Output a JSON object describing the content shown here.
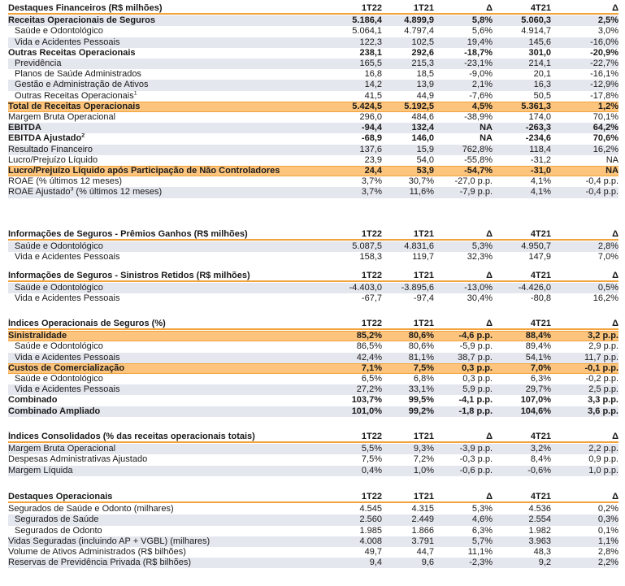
{
  "sections": [
    {
      "header": {
        "label": "Destaques Financeiros (R$ milhões)",
        "v": [
          "1T22",
          "1T21",
          "Δ",
          "4T21",
          "Δ"
        ]
      },
      "rows": [
        {
          "label": "Receitas Operacionais de Seguros",
          "v": [
            "5.186,4",
            "4.899,9",
            "5,8%",
            "5.060,3",
            "2,5%"
          ],
          "style": "bold",
          "shade": true
        },
        {
          "label": "Saúde e Odontológico",
          "v": [
            "5.064,1",
            "4.797,4",
            "5,6%",
            "4.914,7",
            "3,0%"
          ],
          "indent": true
        },
        {
          "label": "Vida e Acidentes Pessoais",
          "v": [
            "122,3",
            "102,5",
            "19,4%",
            "145,6",
            "-16,0%"
          ],
          "indent": true,
          "shade": true
        },
        {
          "label": "Outras Receitas Operacionais",
          "v": [
            "238,1",
            "292,6",
            "-18,7%",
            "301,0",
            "-20,9%"
          ],
          "style": "bold"
        },
        {
          "label": "Previdência",
          "v": [
            "165,5",
            "215,3",
            "-23,1%",
            "214,1",
            "-22,7%"
          ],
          "indent": true,
          "shade": true
        },
        {
          "label": "Planos de Saúde Administrados",
          "v": [
            "16,8",
            "18,5",
            "-9,0%",
            "20,1",
            "-16,1%"
          ],
          "indent": true
        },
        {
          "label": "Gestão e Administração de Ativos",
          "v": [
            "14,2",
            "13,9",
            "2,1%",
            "16,3",
            "-12,9%"
          ],
          "indent": true,
          "shade": true
        },
        {
          "label": "Outras Receitas Operacionais",
          "sup": "1",
          "v": [
            "41,5",
            "44,9",
            "-7,6%",
            "50,5",
            "-17,8%"
          ],
          "indent": true
        },
        {
          "label": "Total de Receitas Operacionais",
          "v": [
            "5.424,5",
            "5.192,5",
            "4,5%",
            "5.361,3",
            "1,2%"
          ],
          "style": "hl"
        },
        {
          "label": "Margem Bruta Operacional",
          "v": [
            "296,0",
            "484,6",
            "-38,9%",
            "174,0",
            "70,1%"
          ]
        },
        {
          "label": "EBITDA",
          "v": [
            "-94,4",
            "132,4",
            "NA",
            "-263,3",
            "64,2%"
          ],
          "style": "bold",
          "shade": true
        },
        {
          "label": "EBITDA Ajustado",
          "sup": "2",
          "v": [
            "-68,9",
            "146,0",
            "NA",
            "-234,6",
            "70,6%"
          ],
          "style": "bold"
        },
        {
          "label": "Resultado Financeiro",
          "v": [
            "137,6",
            "15,9",
            "762,8%",
            "118,4",
            "16,2%"
          ],
          "shade": true
        },
        {
          "label": "Lucro/Prejuízo Líquido",
          "v": [
            "23,9",
            "54,0",
            "-55,8%",
            "-31,2",
            "NA"
          ]
        },
        {
          "label": "Lucro/Prejuízo Líquido após Participação de Não Controladores",
          "v": [
            "24,4",
            "53,9",
            "-54,7%",
            "-31,0",
            "NA"
          ],
          "style": "hl"
        },
        {
          "label": "ROAE (% últimos 12 meses)",
          "v": [
            "3,7%",
            "30,7%",
            "-27,0 p.p.",
            "4,1%",
            "-0,4 p.p."
          ]
        },
        {
          "label": "ROAE Ajustado",
          "sup": "3",
          "label2": " (% últimos 12 meses)",
          "v": [
            "3,7%",
            "11,6%",
            "-7,9 p.p.",
            "4,1%",
            "-0,4 p.p."
          ],
          "shade": true
        }
      ]
    },
    {
      "header": {
        "label": "Informações de Seguros - Prêmios Ganhos (R$ milhões)",
        "v": [
          "1T22",
          "1T21",
          "Δ",
          "4T21",
          "Δ"
        ]
      },
      "rows": [
        {
          "label": "Saúde e Odontológico",
          "v": [
            "5.087,5",
            "4.831,6",
            "5,3%",
            "4.950,7",
            "2,8%"
          ],
          "indent": true,
          "shade": true
        },
        {
          "label": "Vida e Acidentes Pessoais",
          "v": [
            "158,3",
            "119,7",
            "32,3%",
            "147,9",
            "7,0%"
          ],
          "indent": true
        }
      ]
    },
    {
      "header": {
        "label": "Informações de Seguros - Sinistros Retidos (R$ milhões)",
        "v": [
          "1T22",
          "1T21",
          "Δ",
          "4T21",
          "Δ"
        ]
      },
      "rows": [
        {
          "label": "Saúde e Odontológico",
          "v": [
            "-4.403,0",
            "-3.895,6",
            "-13,0%",
            "-4.426,0",
            "0,5%"
          ],
          "indent": true,
          "shade": true
        },
        {
          "label": "Vida e Acidentes Pessoais",
          "v": [
            "-67,7",
            "-97,4",
            "30,4%",
            "-80,8",
            "16,2%"
          ],
          "indent": true
        }
      ]
    },
    {
      "header": {
        "label": "Índices Operacionais de Seguros (%)",
        "v": [
          "1T22",
          "1T21",
          "Δ",
          "4T21",
          "Δ"
        ]
      },
      "rows": [
        {
          "label": "Sinistralidade",
          "v": [
            "85,2%",
            "80,6%",
            "-4,6 p.p.",
            "88,4%",
            "3,2 p.p."
          ],
          "style": "hl"
        },
        {
          "label": "Saúde e Odontológico",
          "v": [
            "86,5%",
            "80,6%",
            "-5,9 p.p.",
            "89,4%",
            "2,9 p.p."
          ],
          "indent": true
        },
        {
          "label": "Vida e Acidentes Pessoais",
          "v": [
            "42,4%",
            "81,1%",
            "38,7 p.p.",
            "54,1%",
            "11,7 p.p."
          ],
          "indent": true,
          "shade": true
        },
        {
          "label": "Custos de Comercialização",
          "v": [
            "7,1%",
            "7,5%",
            "0,3 p.p.",
            "7,0%",
            "-0,1 p.p."
          ],
          "style": "hl"
        },
        {
          "label": "Saúde e Odontológico",
          "v": [
            "6,5%",
            "6,8%",
            "0,3 p.p.",
            "6,3%",
            "-0,2 p.p."
          ],
          "indent": true
        },
        {
          "label": "Vida e Acidentes Pessoais",
          "v": [
            "27,2%",
            "33,1%",
            "5,9 p.p.",
            "29,7%",
            "2,5 p.p."
          ],
          "indent": true,
          "shade": true
        },
        {
          "label": "Combinado",
          "v": [
            "103,7%",
            "99,5%",
            "-4,1 p.p.",
            "107,0%",
            "3,3 p.p."
          ],
          "style": "bold"
        },
        {
          "label": "Combinado Ampliado",
          "v": [
            "101,0%",
            "99,2%",
            "-1,8 p.p.",
            "104,6%",
            "3,6 p.p."
          ],
          "style": "bold",
          "shade": true
        }
      ]
    },
    {
      "header": {
        "label": "Índices Consolidados (% das receitas operacionais totais)",
        "v": [
          "1T22",
          "1T21",
          "Δ",
          "4T21",
          "Δ"
        ]
      },
      "rows": [
        {
          "label": "Margem Bruta Operacional",
          "v": [
            "5,5%",
            "9,3%",
            "-3,9 p.p.",
            "3,2%",
            "2,2 p.p."
          ],
          "shade": true
        },
        {
          "label": "Despesas Administrativas Ajustado",
          "v": [
            "7,5%",
            "7,2%",
            "-0,3 p.p.",
            "8,4%",
            "0,9 p.p."
          ]
        },
        {
          "label": "Margem Líquida",
          "v": [
            "0,4%",
            "1,0%",
            "-0,6 p.p.",
            "-0,6%",
            "1,0 p.p."
          ],
          "shade": true
        }
      ]
    },
    {
      "header": {
        "label": "Destaques Operacionais",
        "v": [
          "1T22",
          "1T21",
          "Δ",
          "4T21",
          "Δ"
        ]
      },
      "rows": [
        {
          "label": "Segurados de Saúde e Odonto (milhares)",
          "v": [
            "4.545",
            "4.315",
            "5,3%",
            "4.536",
            "0,2%"
          ]
        },
        {
          "label": "Segurados de Saúde",
          "v": [
            "2.560",
            "2.449",
            "4,6%",
            "2.554",
            "0,3%"
          ],
          "indent": true,
          "shade": true
        },
        {
          "label": "Segurados de Odonto",
          "v": [
            "1.985",
            "1.866",
            "6,3%",
            "1.982",
            "0,1%"
          ],
          "indent": true
        },
        {
          "label": "Vidas Seguradas (incluindo AP + VGBL) (milhares)",
          "v": [
            "4.008",
            "3.791",
            "5,7%",
            "3.963",
            "1,1%"
          ],
          "shade": true
        },
        {
          "label": "Volume de Ativos Administrados (R$ bilhões)",
          "v": [
            "49,7",
            "44,7",
            "11,1%",
            "48,3",
            "2,8%"
          ]
        },
        {
          "label": "Reservas de Previdência Privada (R$ bilhões)",
          "v": [
            "9,4",
            "9,6",
            "-2,3%",
            "9,2",
            "2,2%"
          ],
          "shade": true
        }
      ]
    }
  ]
}
